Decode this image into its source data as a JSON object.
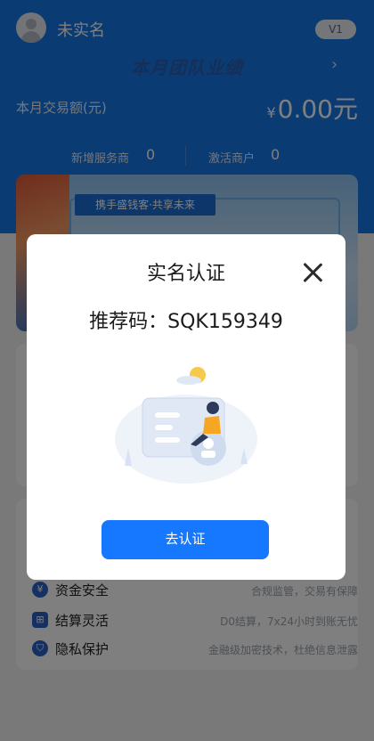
{
  "header": {
    "username": "未实名",
    "level_badge": "V1",
    "team_title": "本月团队业绩",
    "amount_label": "本月交易额(元)",
    "amount_currency": "¥",
    "amount_value": "0.00元",
    "stats": [
      {
        "label": "新增服务商",
        "value": "0"
      },
      {
        "label": "激活商户",
        "value": "0"
      }
    ]
  },
  "banner": {
    "tag": "携手盛钱客·共享未来"
  },
  "features": [
    {
      "icon": "shield-money-icon",
      "title": "资金安全",
      "desc": "合规监管，交易有保障"
    },
    {
      "icon": "settlement-icon",
      "title": "结算灵活",
      "desc": "D0结算，7x24小时到账无忧"
    },
    {
      "icon": "shield-lock-icon",
      "title": "隐私保护",
      "desc": "金融级加密技术，杜绝信息泄露"
    }
  ],
  "modal": {
    "title": "实名认证",
    "referral": "推荐码：SQK159349",
    "button": "去认证"
  },
  "colors": {
    "header_blue": "#1677e6",
    "button_blue": "#1677ff"
  }
}
